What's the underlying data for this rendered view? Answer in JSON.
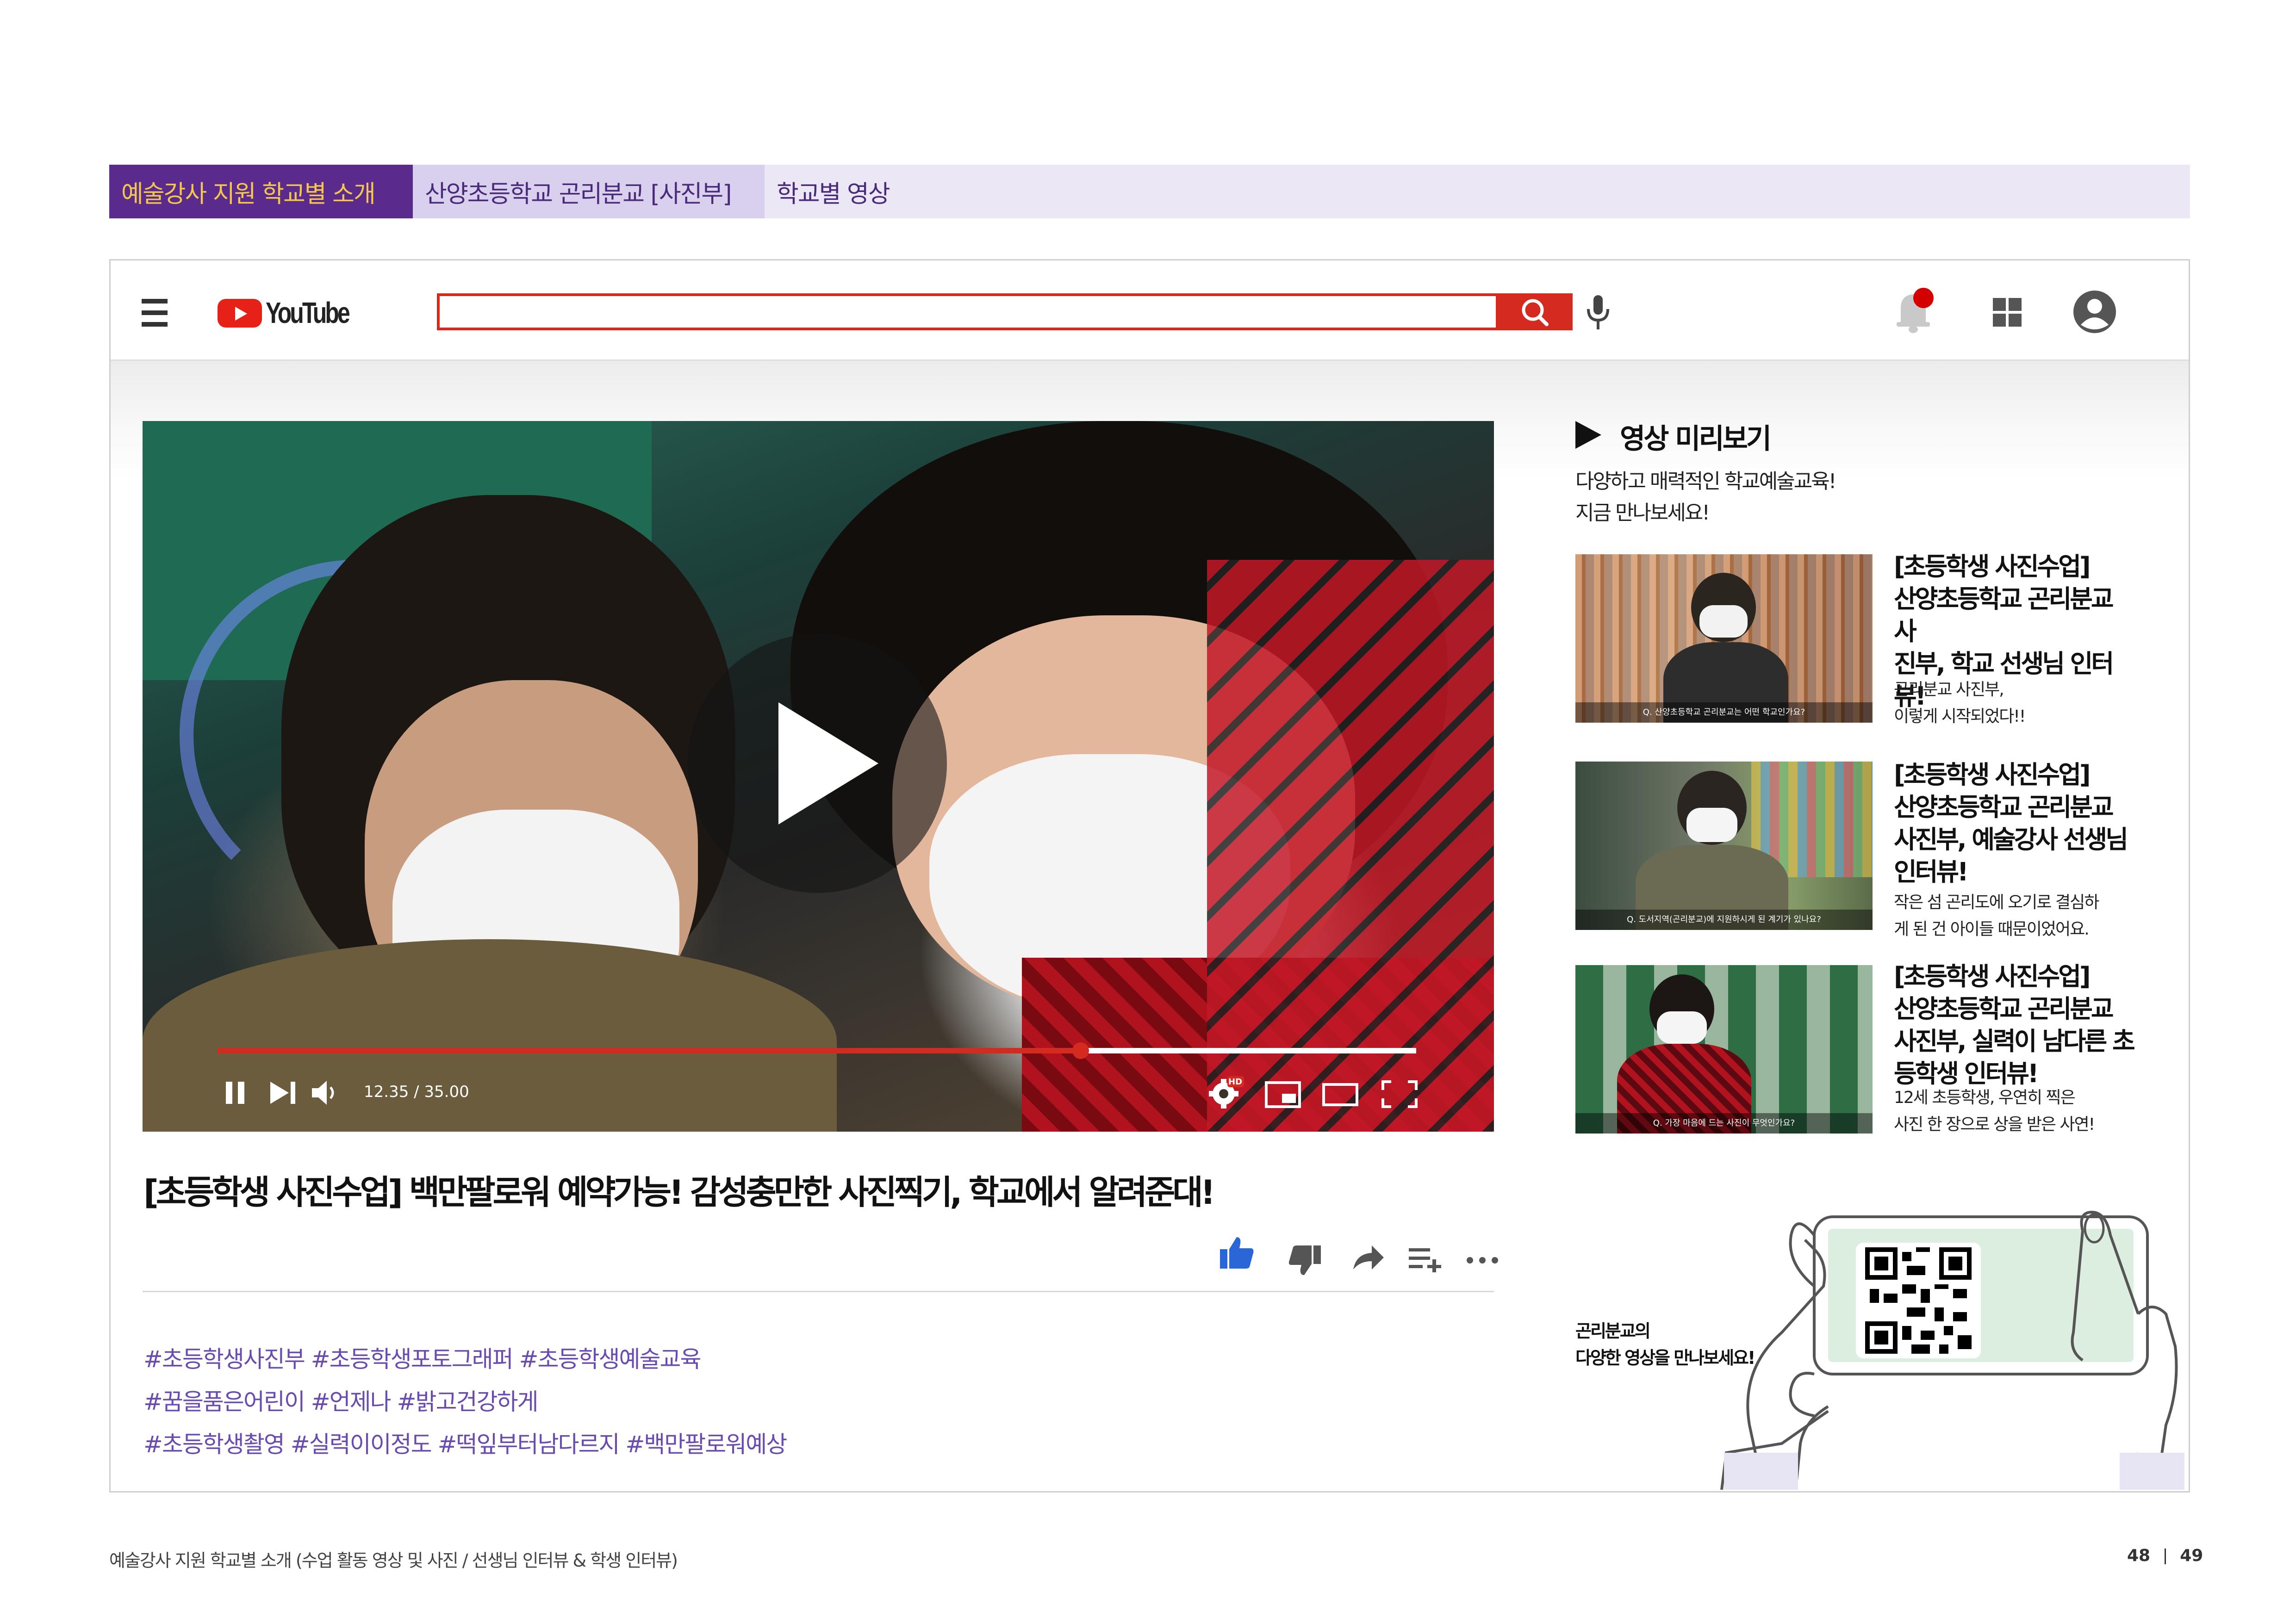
{
  "breadcrumb": [
    "예술강사 지원 학교별 소개",
    "산양초등학교 곤리분교 [사진부]",
    "학교별 영상"
  ],
  "youtube": {
    "logo_text": "YouTube",
    "search_placeholder": ""
  },
  "player": {
    "time": "12.35 / 35.00",
    "progress_fraction": 0.72,
    "hd_badge": "HD"
  },
  "video_title": "[초등학생 사진수업] 백만팔로워 예약가능! 감성충만한 사진찍기, 학교에서 알려준대!",
  "hashtags": [
    "#초등학생사진부 #초등학생포토그래퍼 #초등학생예술교육",
    "#꿈을품은어린이 #언제나 #밝고건강하게",
    "#초등학생촬영 #실력이이정도 #떡잎부터남다르지 #백만팔로워예상"
  ],
  "sidebar": {
    "heading": "영상 미리보기",
    "intro": [
      "다양하고 매력적인 학교예술교육!",
      "지금 만나보세요!"
    ],
    "videos": [
      {
        "title": [
          "[초등학생 사진수업]",
          "산양초등학교 곤리분교 사",
          "진부, 학교 선생님 인터뷰!"
        ],
        "desc": [
          "곤리분교 사진부,",
          "이렇게 시작되었다!!"
        ],
        "caption": "Q. 산양초등학교 곤리분교는 어떤 학교인가요?"
      },
      {
        "title": [
          "[초등학생 사진수업]",
          "산양초등학교 곤리분교",
          "사진부, 예술강사 선생님",
          "인터뷰!"
        ],
        "desc": [
          "작은 섬 곤리도에 오기로 결심하",
          "게 된 건 아이들 때문이었어요."
        ],
        "caption": "Q. 도서지역(곤리분교)에 지원하시게 된 계기가 있나요?"
      },
      {
        "title": [
          "[초등학생 사진수업]",
          "산양초등학교 곤리분교",
          "사진부, 실력이 남다른 초",
          "등학생 인터뷰!"
        ],
        "desc": [
          "12세 초등학생, 우연히 찍은",
          "사진 한 장으로 상을 받은 사연!"
        ],
        "caption": "Q. 가장 마음에 드는 사진이 무엇인가요?"
      }
    ]
  },
  "qr_section": {
    "text": [
      "곤리분교의",
      "다양한 영상을 만나보세요!"
    ]
  },
  "footer": {
    "text": "예술강사 지원 학교별 소개 (수업 활동 영상 및 사진 / 선생님 인터뷰 & 학생 인터뷰)",
    "page_left": "48",
    "page_right": "49"
  },
  "colors": {
    "brand_purple": "#5a2a8c",
    "breadcrumb_gold": "#f3c74b",
    "youtube_red": "#d42a20",
    "hashtag": "#6a4bb0"
  }
}
